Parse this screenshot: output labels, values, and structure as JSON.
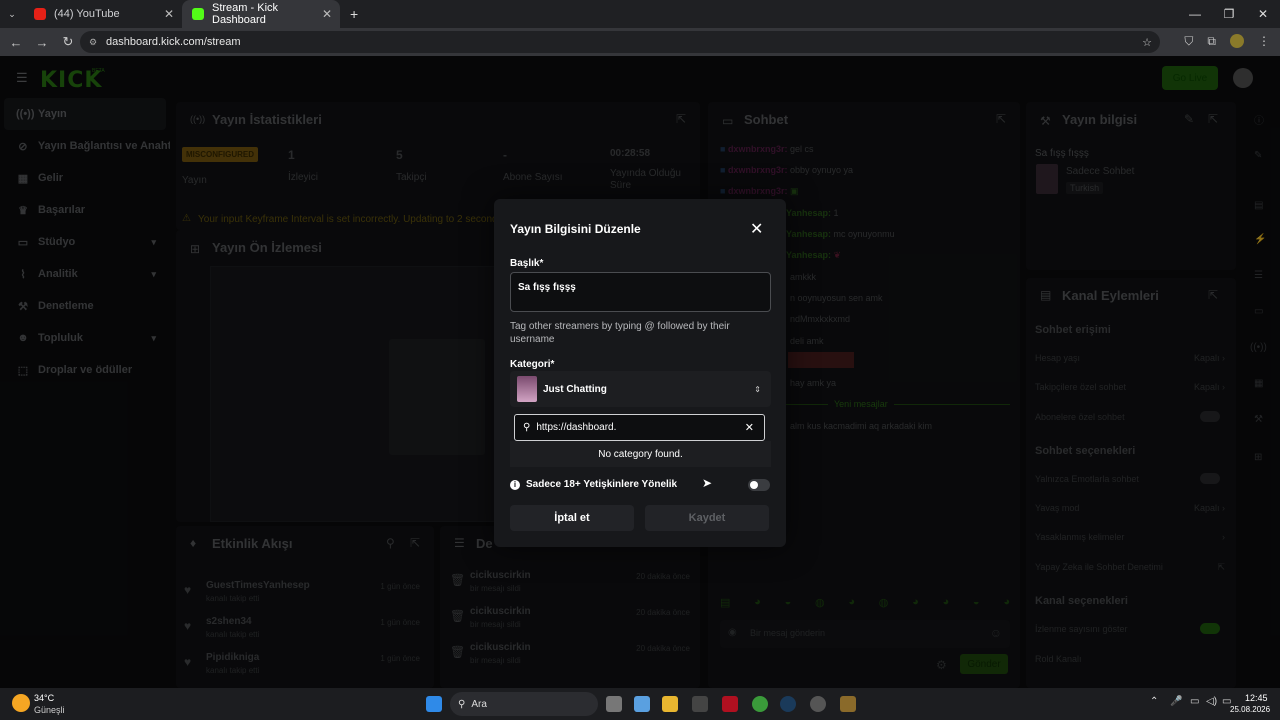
{
  "browser": {
    "tabs": [
      {
        "label": "(44) YouTube",
        "active": false
      },
      {
        "label": "Stream - Kick Dashboard",
        "active": true
      }
    ],
    "url": "dashboard.kick.com/stream"
  },
  "app": {
    "logo": "KICK",
    "logo_badge": "BETA",
    "go_live": "Go Live"
  },
  "sidebar": {
    "items": [
      {
        "label": "Yayın",
        "icon": "broadcast-icon"
      },
      {
        "label": "Yayın Bağlantısı ve Anahtarı",
        "icon": "link-icon"
      },
      {
        "label": "Gelir",
        "icon": "revenue-icon"
      },
      {
        "label": "Başarılar",
        "icon": "trophy-icon"
      },
      {
        "label": "Stüdyo",
        "icon": "studio-icon"
      },
      {
        "label": "Analitik",
        "icon": "analytics-icon"
      },
      {
        "label": "Denetleme",
        "icon": "moderation-icon"
      },
      {
        "label": "Topluluk",
        "icon": "community-icon"
      },
      {
        "label": "Droplar ve ödüller",
        "icon": "drops-icon"
      }
    ]
  },
  "stats": {
    "title": "Yayın İstatistikleri",
    "badge": "MISCONFIGURED",
    "status_label": "Yayın",
    "viewers": "1",
    "viewers_label": "İzleyici",
    "followers": "5",
    "followers_label": "Takipçi",
    "subs": "-",
    "subs_label": "Abone Sayısı",
    "uptime": "00:28:58",
    "uptime_label": "Yayında Olduğu Süre",
    "warning": "Your input Keyframe Interval is set incorrectly. Updating to 2 seconds"
  },
  "preview": {
    "title": "Yayın Ön İzlemesi"
  },
  "activity": {
    "title": "Etkinlik Akışı",
    "items": [
      {
        "name": "GuestTimesYanhesep",
        "sub": "kanalı takip etti",
        "time": "1 gün önce"
      },
      {
        "name": "s2shen34",
        "sub": "kanalı takip etti",
        "time": "1 gün önce"
      },
      {
        "name": "Pipidikniga",
        "sub": "kanalı takip etti",
        "time": "1 gün önce"
      }
    ]
  },
  "deleted": {
    "title": "De",
    "items": [
      {
        "name": "cicikuscirkin",
        "sub": "bir mesajı sildi",
        "time": "20 dakika önce"
      },
      {
        "name": "cicikuscirkin",
        "sub": "bir mesajı sildi",
        "time": "20 dakika önce"
      },
      {
        "name": "cicikuscirkin",
        "sub": "bir mesajı sildi",
        "time": "20 dakika önce"
      }
    ]
  },
  "chat": {
    "title": "Sohbet",
    "messages": [
      {
        "user": "dxwnbrxng3r:",
        "text": "gel cs"
      },
      {
        "user": "dxwnbrxng3r:",
        "text": "obby oynuyo ya"
      },
      {
        "user": "dxwnbrxng3r:",
        "text": ""
      },
      {
        "user": "Yanhesap:",
        "text": "1"
      },
      {
        "user": "Yanhesap:",
        "text": "mc oynuyonmu"
      },
      {
        "user": "Yanhesap:",
        "text": ""
      },
      {
        "user": "",
        "text": "amkkk"
      },
      {
        "user": "",
        "text": "n ooynuyosun sen amk"
      },
      {
        "user": "",
        "text": "ndMmxkxkxmd"
      },
      {
        "user": "",
        "text": "deli amk"
      },
      {
        "user": "",
        "text": "hay amk ya"
      }
    ],
    "new_messages": "Yeni mesajlar",
    "last_message": "alm kus kacmadimi aq arkadaki kim",
    "input_placeholder": "Bir mesaj gönderin",
    "send": "Gönder"
  },
  "stream_info": {
    "title": "Yayın bilgisi",
    "stream_title": "Sa fışş fışşş",
    "category": "Sadece Sohbet",
    "language": "Turkish"
  },
  "channel_actions": {
    "title": "Kanal Eylemleri",
    "chat_access": "Sohbet erişimi",
    "rows1": [
      {
        "label": "Hesap yaşı",
        "value": "Kapalı"
      },
      {
        "label": "Takipçilere özel sohbet",
        "value": "Kapalı"
      },
      {
        "label": "Abonelere özel sohbet",
        "value": ""
      }
    ],
    "chat_options": "Sohbet seçenekleri",
    "rows2": [
      {
        "label": "Yalnızca Emotlarla sohbet",
        "value": ""
      },
      {
        "label": "Yavaş mod",
        "value": "Kapalı"
      },
      {
        "label": "Yasaklanmış kelimeler",
        "value": ""
      },
      {
        "label": "Yapay Zeka ile Sohbet Denetimi",
        "value": ""
      }
    ],
    "channel_options": "Kanal seçenekleri",
    "rows3": [
      {
        "label": "İzlenme sayısını göster",
        "value": ""
      },
      {
        "label": "Rold Kanalı",
        "value": ""
      }
    ]
  },
  "modal": {
    "title": "Yayın Bilgisini Düzenle",
    "title_label": "Başlık*",
    "title_value": "Sa fışş fışşş",
    "hint": "Tag other streamers by typing @ followed by their username",
    "category_label": "Kategori*",
    "category_value": "Just Chatting",
    "search_value": "https://dashboard.",
    "no_result": "No category found.",
    "adult_label": "Sadece 18+ Yetişkinlere Yönelik",
    "cancel": "İptal et",
    "save": "Kaydet"
  },
  "taskbar": {
    "temp": "34°C",
    "weather": "Güneşli",
    "search": "Ara",
    "time": "12:45",
    "date": "25.08.2026"
  }
}
